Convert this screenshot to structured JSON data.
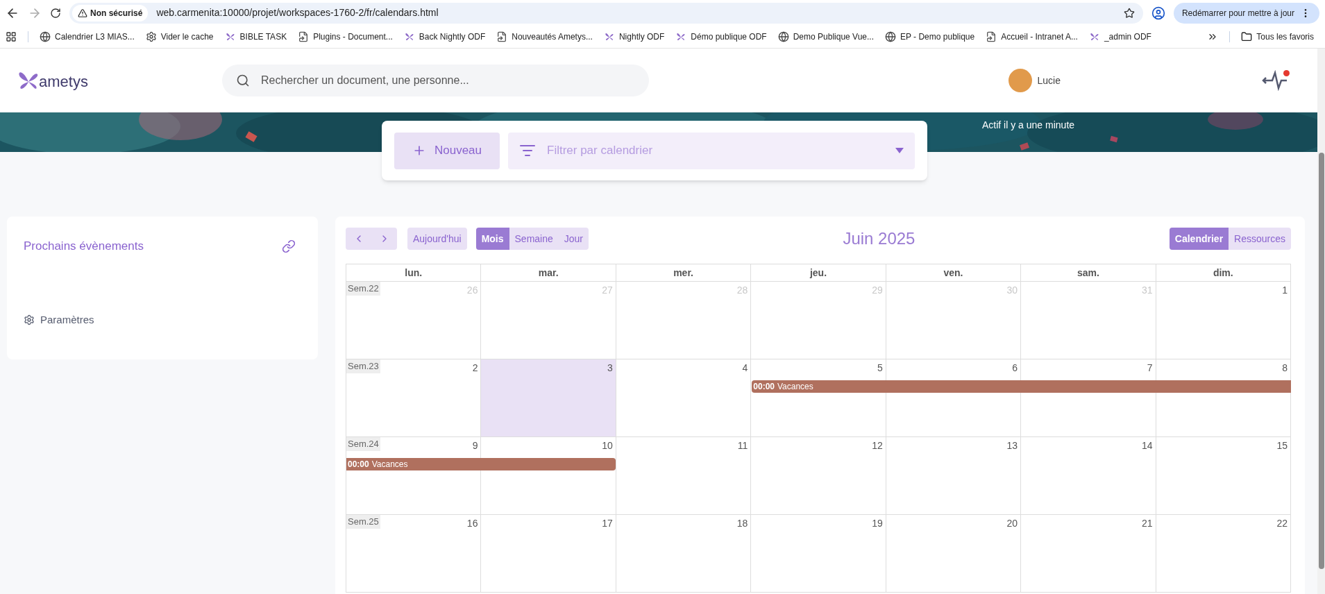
{
  "browser": {
    "security": "Non sécurisé",
    "url": "web.carmenita:10000/projet/workspaces-1760-2/fr/calendars.html",
    "update_button": "Redémarrer pour mettre à jour",
    "bookmarks": [
      {
        "label": "Calendrier L3 MIAS...",
        "kind": "globe"
      },
      {
        "label": "Vider le cache",
        "kind": "gear"
      },
      {
        "label": "BIBLE TASK",
        "kind": "butterfly"
      },
      {
        "label": "Plugins - Document...",
        "kind": "page"
      },
      {
        "label": "Back Nightly ODF",
        "kind": "butterfly"
      },
      {
        "label": "Nouveautés Ametys...",
        "kind": "page"
      },
      {
        "label": "Nightly ODF",
        "kind": "butterfly"
      },
      {
        "label": "Démo publique ODF",
        "kind": "butterfly"
      },
      {
        "label": "Demo Publique Vue...",
        "kind": "globe"
      },
      {
        "label": "EP - Demo publique",
        "kind": "globe"
      },
      {
        "label": "Accueil - Intranet A...",
        "kind": "page"
      },
      {
        "label": "_admin ODF",
        "kind": "butterfly"
      }
    ],
    "all_bookmarks": "Tous les favoris"
  },
  "header": {
    "logo": "ametys",
    "search_placeholder": "Rechercher un document, une personne...",
    "user": "Lucie",
    "activity_alert": true
  },
  "banner": {
    "status": "Actif il y a une minute"
  },
  "toolbar": {
    "new_button": "Nouveau",
    "filter_placeholder": "Filtrer par calendrier"
  },
  "sidebar": {
    "title": "Prochains évènements",
    "settings": "Paramètres"
  },
  "calendar": {
    "today_button": "Aujourd'hui",
    "title": "Juin 2025",
    "views": [
      {
        "label": "Mois",
        "selected": true
      },
      {
        "label": "Semaine",
        "selected": false
      },
      {
        "label": "Jour",
        "selected": false
      }
    ],
    "modes": [
      {
        "label": "Calendrier",
        "selected": true
      },
      {
        "label": "Ressources",
        "selected": false
      }
    ],
    "weekdays": [
      "lun.",
      "mar.",
      "mer.",
      "jeu.",
      "ven.",
      "sam.",
      "dim."
    ],
    "weeks": [
      {
        "label": "Sem.22",
        "days": [
          {
            "number": "26",
            "muted": true,
            "today": false
          },
          {
            "number": "27",
            "muted": true,
            "today": false
          },
          {
            "number": "28",
            "muted": true,
            "today": false
          },
          {
            "number": "29",
            "muted": true,
            "today": false
          },
          {
            "number": "30",
            "muted": true,
            "today": false
          },
          {
            "number": "31",
            "muted": true,
            "today": false
          },
          {
            "number": "1",
            "muted": false,
            "today": false
          }
        ]
      },
      {
        "label": "Sem.23",
        "days": [
          {
            "number": "2",
            "muted": false,
            "today": false
          },
          {
            "number": "3",
            "muted": false,
            "today": true
          },
          {
            "number": "4",
            "muted": false,
            "today": false
          },
          {
            "number": "5",
            "muted": false,
            "today": false,
            "in_event": true,
            "event": {
              "time": "00:00",
              "title": "Vacances",
              "color": "#b0705e",
              "starts_here": true,
              "ends_here": false
            }
          },
          {
            "number": "6",
            "muted": false,
            "today": false,
            "in_event": true
          },
          {
            "number": "7",
            "muted": false,
            "today": false,
            "in_event": true
          },
          {
            "number": "8",
            "muted": false,
            "today": false,
            "in_event": true
          }
        ]
      },
      {
        "label": "Sem.24",
        "days": [
          {
            "number": "9",
            "muted": false,
            "today": false,
            "in_event": true,
            "event": {
              "time": "00:00",
              "title": "Vacances",
              "color": "#b0705e",
              "starts_here": false,
              "ends_here": true
            }
          },
          {
            "number": "10",
            "muted": false,
            "today": false,
            "in_event": true
          },
          {
            "number": "11",
            "muted": false,
            "today": false
          },
          {
            "number": "12",
            "muted": false,
            "today": false
          },
          {
            "number": "13",
            "muted": false,
            "today": false
          },
          {
            "number": "14",
            "muted": false,
            "today": false
          },
          {
            "number": "15",
            "muted": false,
            "today": false
          }
        ]
      },
      {
        "label": "Sem.25",
        "days": [
          {
            "number": "16",
            "muted": false,
            "today": false
          },
          {
            "number": "17",
            "muted": false,
            "today": false
          },
          {
            "number": "18",
            "muted": false,
            "today": false
          },
          {
            "number": "19",
            "muted": false,
            "today": false
          },
          {
            "number": "20",
            "muted": false,
            "today": false
          },
          {
            "number": "21",
            "muted": false,
            "today": false
          },
          {
            "number": "22",
            "muted": false,
            "today": false
          }
        ]
      }
    ]
  }
}
